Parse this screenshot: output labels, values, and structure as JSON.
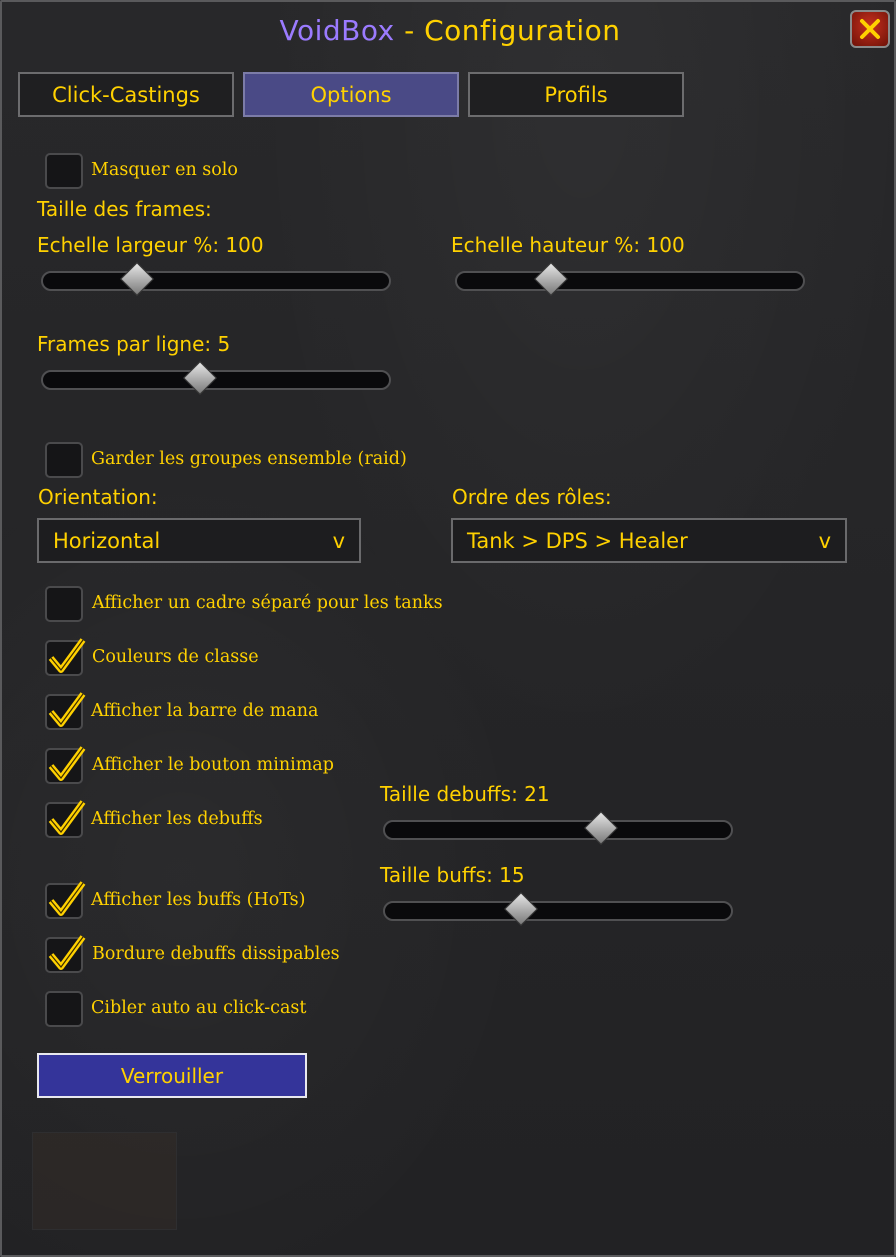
{
  "window": {
    "brand": "VoidBox",
    "separator": " - ",
    "title": "Configuration",
    "close_icon": "close-x-icon"
  },
  "tabs": [
    {
      "label": "Click-Castings",
      "active": false
    },
    {
      "label": "Options",
      "active": true
    },
    {
      "label": "Profils",
      "active": false
    }
  ],
  "options": {
    "hide_solo": {
      "label": "Masquer en solo",
      "checked": false
    },
    "frame_size_heading": "Taille des frames:",
    "width_scale": {
      "label": "Echelle largeur %: 100",
      "value": 100
    },
    "height_scale": {
      "label": "Echelle hauteur %: 100",
      "value": 100
    },
    "frames_per_row": {
      "label": "Frames par ligne: 5",
      "value": 5
    },
    "keep_groups": {
      "label": "Garder les groupes ensemble (raid)",
      "checked": false
    },
    "orientation": {
      "label": "Orientation:",
      "value": "Horizontal",
      "arrow": "v"
    },
    "role_order": {
      "label": "Ordre des rôles:",
      "value": "Tank > DPS > Healer",
      "arrow": "v"
    },
    "tank_frame": {
      "label": "Afficher un cadre séparé pour les tanks",
      "checked": false
    },
    "class_colors": {
      "label": "Couleurs de classe",
      "checked": true
    },
    "mana_bar": {
      "label": "Afficher la barre de mana",
      "checked": true
    },
    "minimap_button": {
      "label": "Afficher le bouton minimap",
      "checked": true
    },
    "show_debuffs": {
      "label": "Afficher les debuffs",
      "checked": true
    },
    "debuff_size": {
      "label": "Taille debuffs: 21",
      "value": 21
    },
    "buff_size": {
      "label": "Taille buffs: 15",
      "value": 15
    },
    "show_buffs": {
      "label": "Afficher les buffs (HoTs)",
      "checked": true
    },
    "dispel_border": {
      "label": "Bordure debuffs dissipables",
      "checked": true
    },
    "auto_target": {
      "label": "Cibler auto au click-cast",
      "checked": false
    }
  },
  "lock_button": "Verrouiller",
  "colors": {
    "text": "#ffd100",
    "brand": "#9b7bff",
    "active_tab": "#4a4a86",
    "lock_button": "#34349a"
  }
}
